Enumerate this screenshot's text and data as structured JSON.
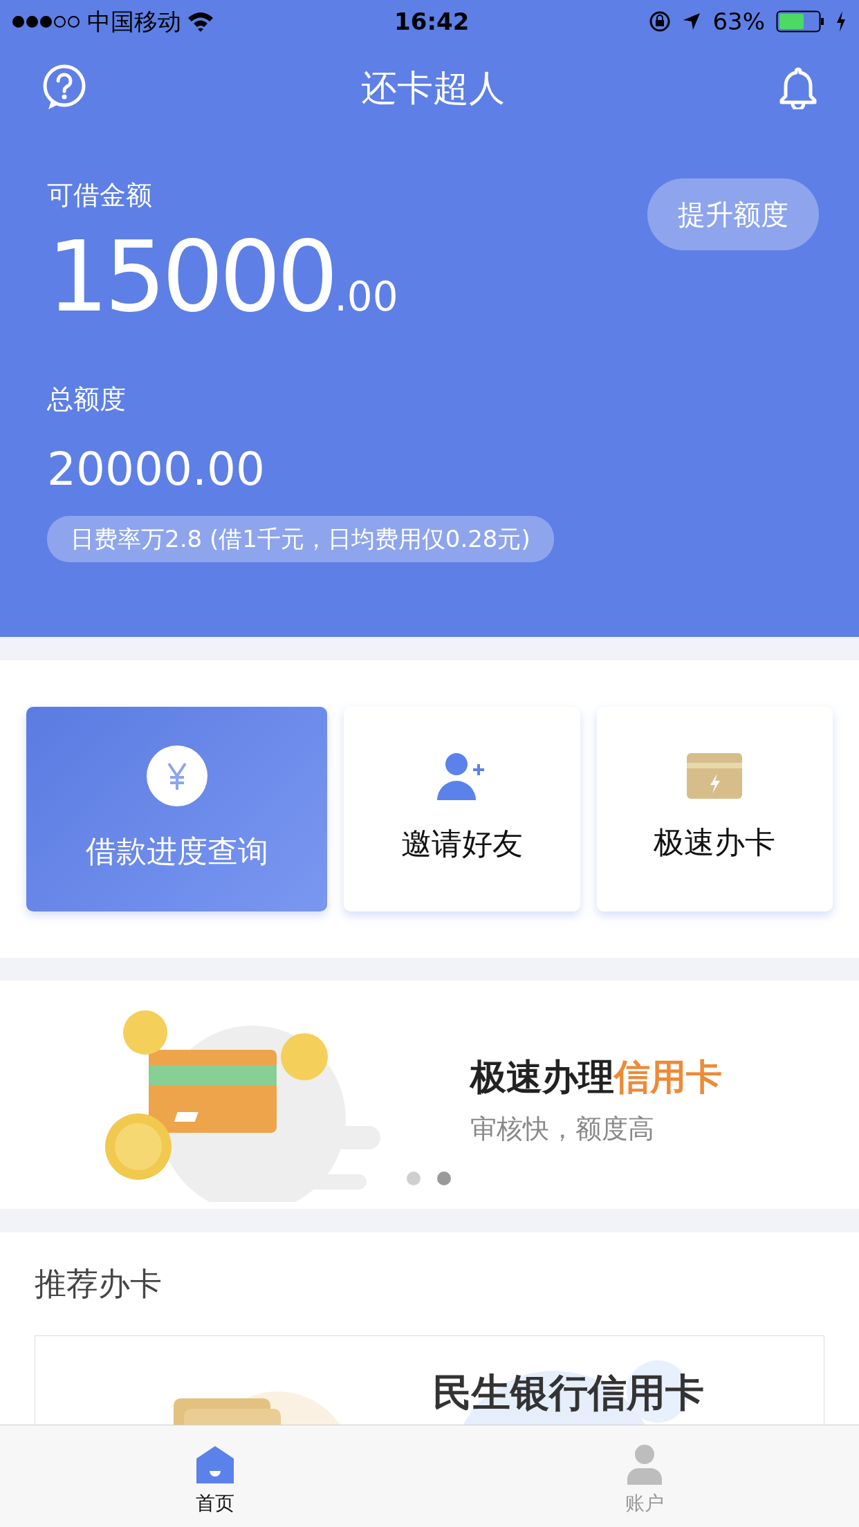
{
  "status_bar": {
    "signal_dots": [
      {
        "filled": true
      },
      {
        "filled": true
      },
      {
        "filled": true
      },
      {
        "filled": false
      },
      {
        "filled": false
      }
    ],
    "carrier": "中国移动",
    "time": "16:42",
    "battery": "63%"
  },
  "header": {
    "title": "还卡超人"
  },
  "balance": {
    "label": "可借金额",
    "amount": "15000",
    "amount_decimal": ".00",
    "raise_button": "提升额度",
    "total_label": "总额度",
    "total": "20000.00",
    "rate_note": "日费率万2.8 (借1千元，日均费用仅0.28元)"
  },
  "shortcuts": [
    {
      "label": "借款进度查询",
      "kind": "yuan",
      "selected": true
    },
    {
      "label": "邀请好友",
      "kind": "invite",
      "selected": false
    },
    {
      "label": "极速办卡",
      "kind": "card",
      "selected": false
    }
  ],
  "banner": {
    "title": "极速办理",
    "title_accent": "信用卡",
    "subtitle": "审核快，额度高",
    "dots": [
      {
        "selected": false
      },
      {
        "selected": true
      }
    ]
  },
  "recommend": {
    "title": "推荐办卡",
    "card_title": "民生银行信用卡"
  },
  "tabs": [
    {
      "label": "首页",
      "kind": "home",
      "selected": true
    },
    {
      "label": "账户",
      "kind": "account",
      "selected": false
    }
  ]
}
